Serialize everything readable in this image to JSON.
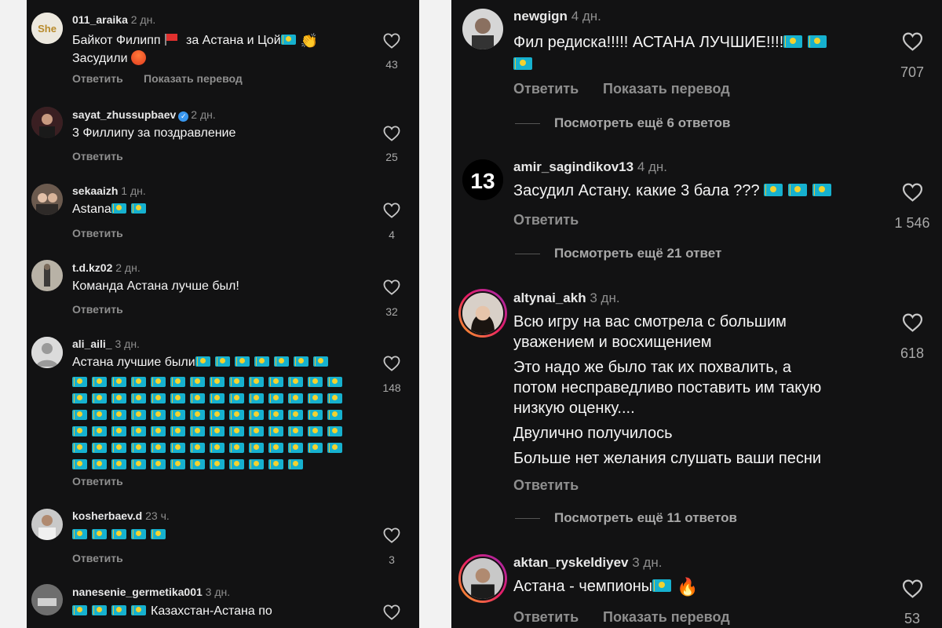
{
  "left": {
    "comments": [
      {
        "username": "011_araika",
        "time": "2 дн.",
        "text_a": "Байкот Филипп",
        "text_b": "за Астана и Цой",
        "text_c": "Засудили",
        "reply": "Ответить",
        "translate": "Показать перевод",
        "likes": "43"
      },
      {
        "username": "sayat_zhussupbaev",
        "time": "2 дн.",
        "text": "3 Филлипу за поздравление",
        "reply": "Ответить",
        "likes": "25"
      },
      {
        "username": "sekaaizh",
        "time": "1 дн.",
        "text": "Astana",
        "reply": "Ответить",
        "likes": "4"
      },
      {
        "username": "t.d.kz02",
        "time": "2 дн.",
        "text": "Команда Астана лучше был!",
        "reply": "Ответить",
        "likes": "32"
      },
      {
        "username": "ali_aili_",
        "time": "3 дн.",
        "text": "Астана лучшие были",
        "reply": "Ответить",
        "likes": "148"
      },
      {
        "username": "kosherbaev.d",
        "time": "23 ч.",
        "reply": "Ответить",
        "likes": "3"
      },
      {
        "username": "nanesenie_germetika001",
        "time": "3 дн.",
        "text": "Казахстан-Астана по"
      }
    ]
  },
  "right": {
    "comments": [
      {
        "username": "newgign",
        "time": "4 дн.",
        "text": "Фил редиска!!!!! АСТАНА ЛУЧШИЕ!!!!",
        "reply": "Ответить",
        "translate": "Показать перевод",
        "likes": "707",
        "more": "Посмотреть ещё 6 ответов"
      },
      {
        "username": "amir_sagindikov13",
        "time": "4 дн.",
        "avatar_text": "13",
        "text": "Засудил Астану. какие 3 бала ???",
        "reply": "Ответить",
        "likes": "1 546",
        "more": "Посмотреть ещё 21 ответ"
      },
      {
        "username": "altynai_akh",
        "time": "3 дн.",
        "line1": "Всю игру на вас смотрела с большим",
        "line2": "уважением и восхищением",
        "line3": "Это надо же было так их похвалить, а",
        "line4": "потом несправедливо поставить им такую",
        "line5": "низкую оценку....",
        "line6": "Двулично получилось",
        "line7": "Больше нет желания слушать ваши песни",
        "reply": "Ответить",
        "likes": "618",
        "more": "Посмотреть ещё 11 ответов"
      },
      {
        "username": "aktan_ryskeldiyev",
        "time": "3 дн.",
        "text": "Астана - чемпионы",
        "reply": "Ответить",
        "translate": "Показать перевод",
        "likes": "53"
      }
    ]
  },
  "colors": {
    "background": "#121213",
    "text": "#f5f5f5",
    "muted": "#8e8e8e",
    "verified": "#3897f0"
  },
  "icons": [
    "heart-icon",
    "kazakhstan-flag-icon",
    "verified-badge-icon",
    "fire-icon",
    "clapping-hands-icon",
    "angry-face-icon",
    "red-flag-icon"
  ]
}
